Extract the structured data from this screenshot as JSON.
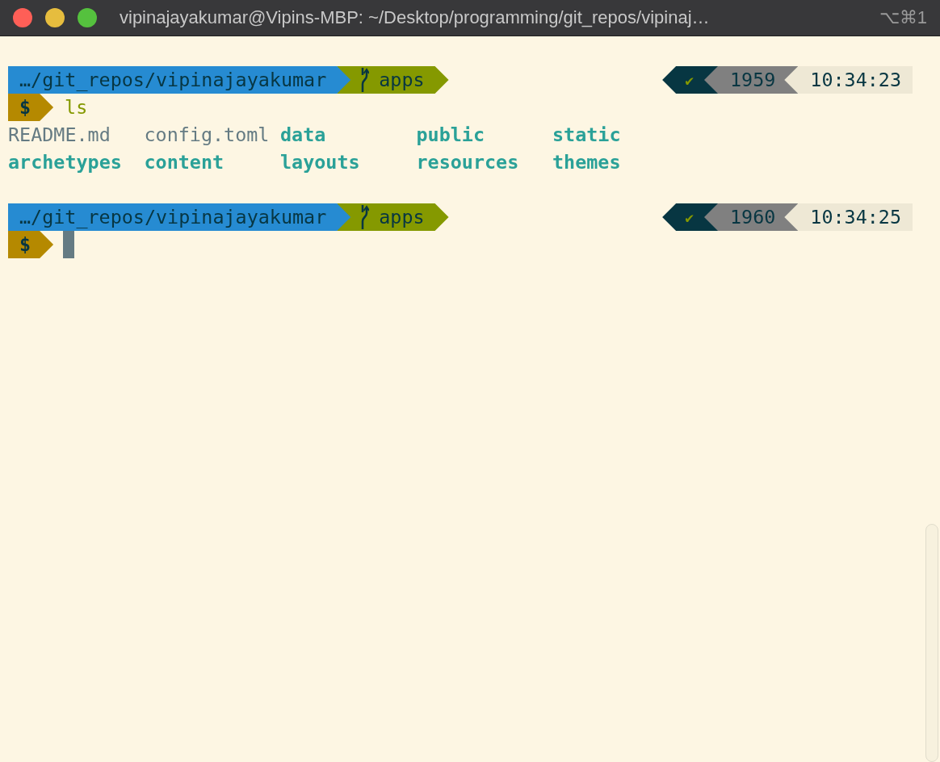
{
  "window": {
    "title": "vipinajayakumar@Vipins-MBP: ~/Desktop/programming/git_repos/vipinaj…",
    "shortcut": "⌥⌘1"
  },
  "blocks": [
    {
      "path": "…/git_repos/vipinajayakumar",
      "branch": "apps",
      "status": "✔",
      "success": true,
      "count": "1959",
      "time": "10:34:23",
      "symbol": "$",
      "command": "ls",
      "cursor": false,
      "output": [
        [
          {
            "name": "README.md",
            "kind": "file"
          },
          {
            "name": "config.toml",
            "kind": "file"
          },
          {
            "name": "data",
            "kind": "dir"
          },
          {
            "name": "public",
            "kind": "dir"
          },
          {
            "name": "static",
            "kind": "dir"
          }
        ],
        [
          {
            "name": "archetypes",
            "kind": "dir"
          },
          {
            "name": "content",
            "kind": "dir"
          },
          {
            "name": "layouts",
            "kind": "dir"
          },
          {
            "name": "resources",
            "kind": "dir"
          },
          {
            "name": "themes",
            "kind": "dir"
          }
        ]
      ]
    },
    {
      "path": "…/git_repos/vipinajayakumar",
      "branch": "apps",
      "status": "✔",
      "success": true,
      "count": "1960",
      "time": "10:34:25",
      "symbol": "$",
      "cursor": true
    }
  ]
}
